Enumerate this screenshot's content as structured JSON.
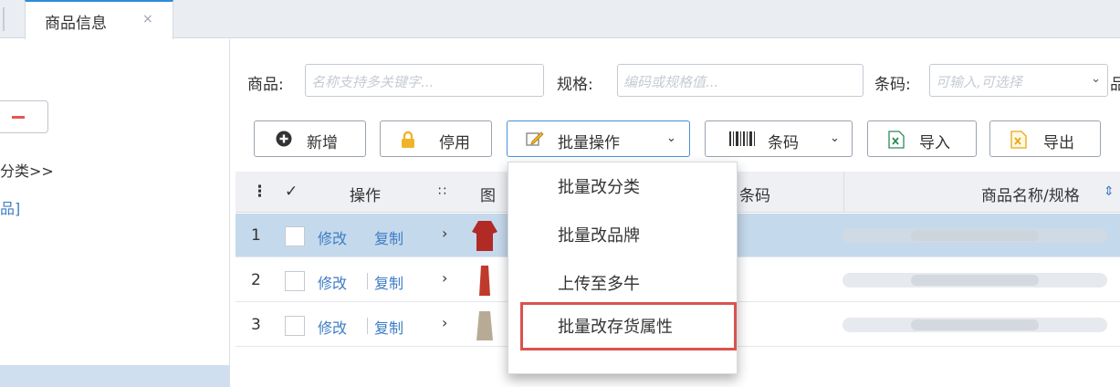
{
  "tabs": [
    {
      "label": "商品信息",
      "close": "×"
    }
  ],
  "left_panel": {
    "category_text": "分类>>",
    "link_text": "品]"
  },
  "search": {
    "product_label": "商品:",
    "product_placeholder": "名称支持多关键字...",
    "spec_label": "规格:",
    "spec_placeholder": "编码或规格值...",
    "barcode_label": "条码:",
    "barcode_placeholder": "可输入,可选择",
    "next_label": "品"
  },
  "toolbar": {
    "add": "新增",
    "disable": "停用",
    "batch": "批量操作",
    "barcode": "条码",
    "import": "导入",
    "export": "导出"
  },
  "grid": {
    "headers": {
      "ops": "操作",
      "image": "图",
      "barcode": "条码",
      "name": "商品名称/规格"
    },
    "rows": [
      {
        "n": "1",
        "edit": "修改",
        "copy": "复制",
        "selected": true,
        "thumb_color": "#b22a26"
      },
      {
        "n": "2",
        "edit": "修改",
        "copy": "复制",
        "selected": false,
        "thumb_color": "#c03a2c"
      },
      {
        "n": "3",
        "edit": "修改",
        "copy": "复制",
        "selected": false,
        "thumb_color": "#b8ab96"
      }
    ]
  },
  "batch_menu": {
    "items": [
      "批量改分类",
      "批量改品牌",
      "上传至多牛",
      "批量改存货属性"
    ],
    "highlighted_index": 3,
    "highlight_color": "#d9534f"
  },
  "colors": {
    "accent": "#2d8cd7",
    "link": "#3d7dc4",
    "selected_row": "#c5d9ec",
    "danger": "#e25950"
  }
}
